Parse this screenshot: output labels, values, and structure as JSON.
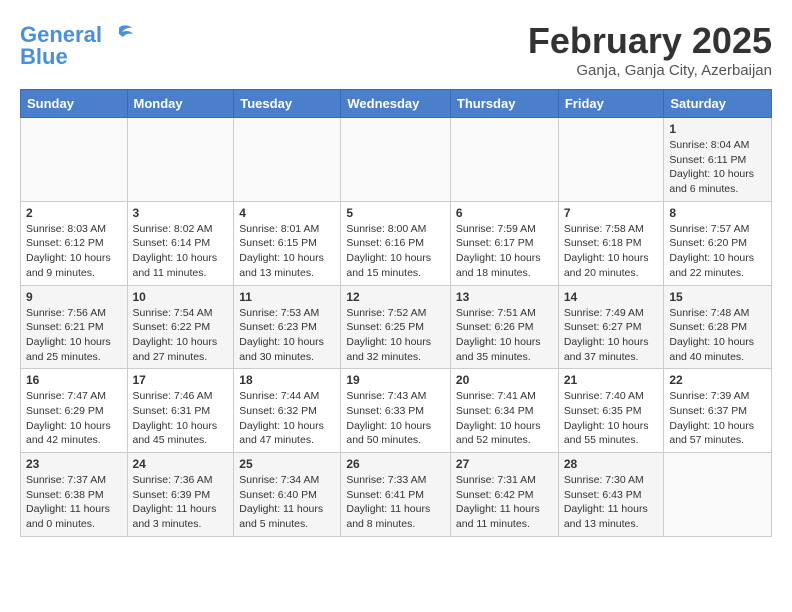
{
  "header": {
    "logo_general": "General",
    "logo_blue": "Blue",
    "main_title": "February 2025",
    "subtitle": "Ganja, Ganja City, Azerbaijan"
  },
  "days_of_week": [
    "Sunday",
    "Monday",
    "Tuesday",
    "Wednesday",
    "Thursday",
    "Friday",
    "Saturday"
  ],
  "weeks": [
    [
      {
        "day": "",
        "info": ""
      },
      {
        "day": "",
        "info": ""
      },
      {
        "day": "",
        "info": ""
      },
      {
        "day": "",
        "info": ""
      },
      {
        "day": "",
        "info": ""
      },
      {
        "day": "",
        "info": ""
      },
      {
        "day": "1",
        "info": "Sunrise: 8:04 AM\nSunset: 6:11 PM\nDaylight: 10 hours and 6 minutes."
      }
    ],
    [
      {
        "day": "2",
        "info": "Sunrise: 8:03 AM\nSunset: 6:12 PM\nDaylight: 10 hours and 9 minutes."
      },
      {
        "day": "3",
        "info": "Sunrise: 8:02 AM\nSunset: 6:14 PM\nDaylight: 10 hours and 11 minutes."
      },
      {
        "day": "4",
        "info": "Sunrise: 8:01 AM\nSunset: 6:15 PM\nDaylight: 10 hours and 13 minutes."
      },
      {
        "day": "5",
        "info": "Sunrise: 8:00 AM\nSunset: 6:16 PM\nDaylight: 10 hours and 15 minutes."
      },
      {
        "day": "6",
        "info": "Sunrise: 7:59 AM\nSunset: 6:17 PM\nDaylight: 10 hours and 18 minutes."
      },
      {
        "day": "7",
        "info": "Sunrise: 7:58 AM\nSunset: 6:18 PM\nDaylight: 10 hours and 20 minutes."
      },
      {
        "day": "8",
        "info": "Sunrise: 7:57 AM\nSunset: 6:20 PM\nDaylight: 10 hours and 22 minutes."
      }
    ],
    [
      {
        "day": "9",
        "info": "Sunrise: 7:56 AM\nSunset: 6:21 PM\nDaylight: 10 hours and 25 minutes."
      },
      {
        "day": "10",
        "info": "Sunrise: 7:54 AM\nSunset: 6:22 PM\nDaylight: 10 hours and 27 minutes."
      },
      {
        "day": "11",
        "info": "Sunrise: 7:53 AM\nSunset: 6:23 PM\nDaylight: 10 hours and 30 minutes."
      },
      {
        "day": "12",
        "info": "Sunrise: 7:52 AM\nSunset: 6:25 PM\nDaylight: 10 hours and 32 minutes."
      },
      {
        "day": "13",
        "info": "Sunrise: 7:51 AM\nSunset: 6:26 PM\nDaylight: 10 hours and 35 minutes."
      },
      {
        "day": "14",
        "info": "Sunrise: 7:49 AM\nSunset: 6:27 PM\nDaylight: 10 hours and 37 minutes."
      },
      {
        "day": "15",
        "info": "Sunrise: 7:48 AM\nSunset: 6:28 PM\nDaylight: 10 hours and 40 minutes."
      }
    ],
    [
      {
        "day": "16",
        "info": "Sunrise: 7:47 AM\nSunset: 6:29 PM\nDaylight: 10 hours and 42 minutes."
      },
      {
        "day": "17",
        "info": "Sunrise: 7:46 AM\nSunset: 6:31 PM\nDaylight: 10 hours and 45 minutes."
      },
      {
        "day": "18",
        "info": "Sunrise: 7:44 AM\nSunset: 6:32 PM\nDaylight: 10 hours and 47 minutes."
      },
      {
        "day": "19",
        "info": "Sunrise: 7:43 AM\nSunset: 6:33 PM\nDaylight: 10 hours and 50 minutes."
      },
      {
        "day": "20",
        "info": "Sunrise: 7:41 AM\nSunset: 6:34 PM\nDaylight: 10 hours and 52 minutes."
      },
      {
        "day": "21",
        "info": "Sunrise: 7:40 AM\nSunset: 6:35 PM\nDaylight: 10 hours and 55 minutes."
      },
      {
        "day": "22",
        "info": "Sunrise: 7:39 AM\nSunset: 6:37 PM\nDaylight: 10 hours and 57 minutes."
      }
    ],
    [
      {
        "day": "23",
        "info": "Sunrise: 7:37 AM\nSunset: 6:38 PM\nDaylight: 11 hours and 0 minutes."
      },
      {
        "day": "24",
        "info": "Sunrise: 7:36 AM\nSunset: 6:39 PM\nDaylight: 11 hours and 3 minutes."
      },
      {
        "day": "25",
        "info": "Sunrise: 7:34 AM\nSunset: 6:40 PM\nDaylight: 11 hours and 5 minutes."
      },
      {
        "day": "26",
        "info": "Sunrise: 7:33 AM\nSunset: 6:41 PM\nDaylight: 11 hours and 8 minutes."
      },
      {
        "day": "27",
        "info": "Sunrise: 7:31 AM\nSunset: 6:42 PM\nDaylight: 11 hours and 11 minutes."
      },
      {
        "day": "28",
        "info": "Sunrise: 7:30 AM\nSunset: 6:43 PM\nDaylight: 11 hours and 13 minutes."
      },
      {
        "day": "",
        "info": ""
      }
    ]
  ]
}
